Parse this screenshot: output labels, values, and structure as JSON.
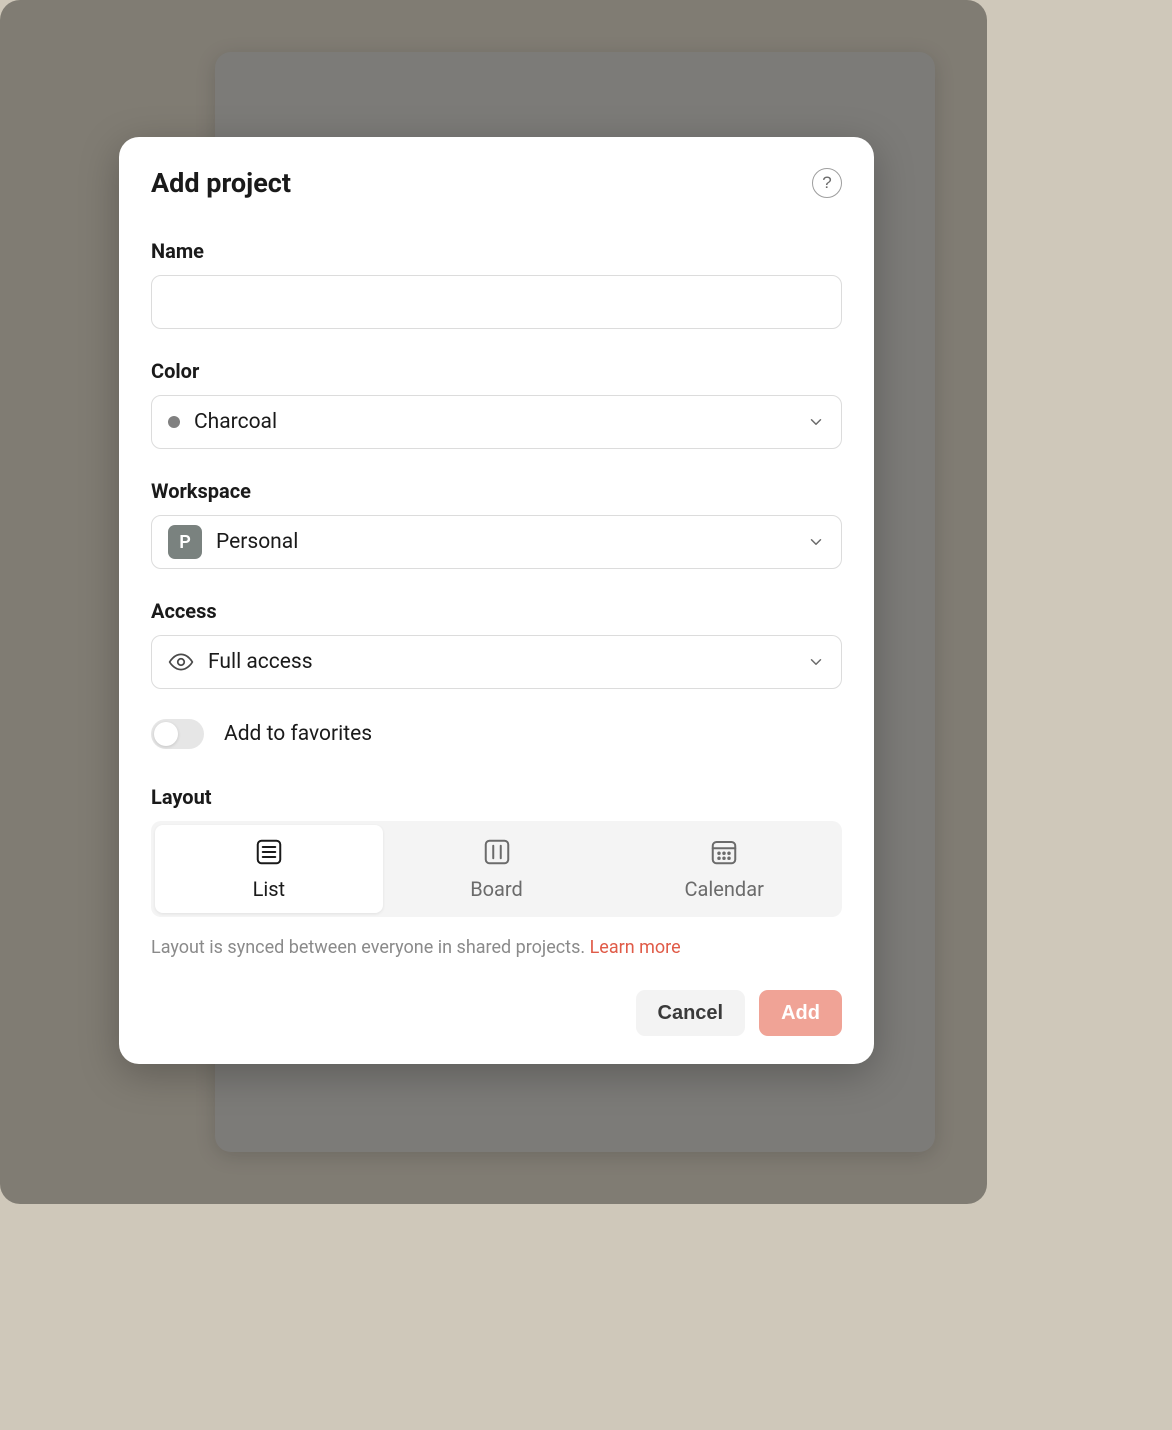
{
  "modal": {
    "title": "Add project"
  },
  "fields": {
    "name": {
      "label": "Name",
      "value": ""
    },
    "color": {
      "label": "Color",
      "selected": "Charcoal",
      "swatch": "#808080"
    },
    "workspace": {
      "label": "Workspace",
      "selected": "Personal",
      "badge": "P"
    },
    "access": {
      "label": "Access",
      "selected": "Full access"
    },
    "favorites": {
      "label": "Add to favorites",
      "on": false
    },
    "layout": {
      "label": "Layout",
      "options": [
        {
          "key": "list",
          "label": "List",
          "active": true
        },
        {
          "key": "board",
          "label": "Board",
          "active": false
        },
        {
          "key": "calendar",
          "label": "Calendar",
          "active": false
        }
      ],
      "hint": "Layout is synced between everyone in shared projects. ",
      "learn_more": "Learn more"
    }
  },
  "footer": {
    "cancel": "Cancel",
    "add": "Add"
  }
}
